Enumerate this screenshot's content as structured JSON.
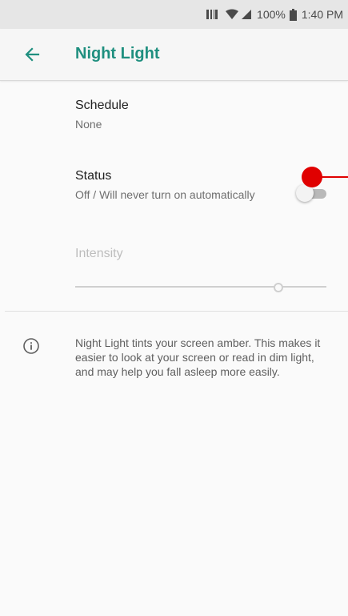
{
  "status_bar": {
    "battery_percent": "100%",
    "time": "1:40 PM",
    "icons": [
      "scanner-icon",
      "wifi-icon",
      "signal-icon",
      "battery-icon"
    ]
  },
  "app_bar": {
    "title": "Night Light",
    "back_icon": "back-arrow-icon"
  },
  "preferences": {
    "schedule": {
      "title": "Schedule",
      "summary": "None"
    },
    "status": {
      "title": "Status",
      "summary": "Off / Will never turn on automatically",
      "toggle_on": false
    },
    "intensity": {
      "title": "Intensity",
      "level": 0.81,
      "enabled": false
    }
  },
  "footer": {
    "info_icon": "info-icon",
    "text": "Night Light tints your screen amber. This makes it easier to look at your screen or read in dim light, and may help you fall asleep more easily."
  },
  "colors": {
    "accent": "#1f8f7f",
    "tap_marker": "#e00000",
    "background": "#fafafa"
  }
}
